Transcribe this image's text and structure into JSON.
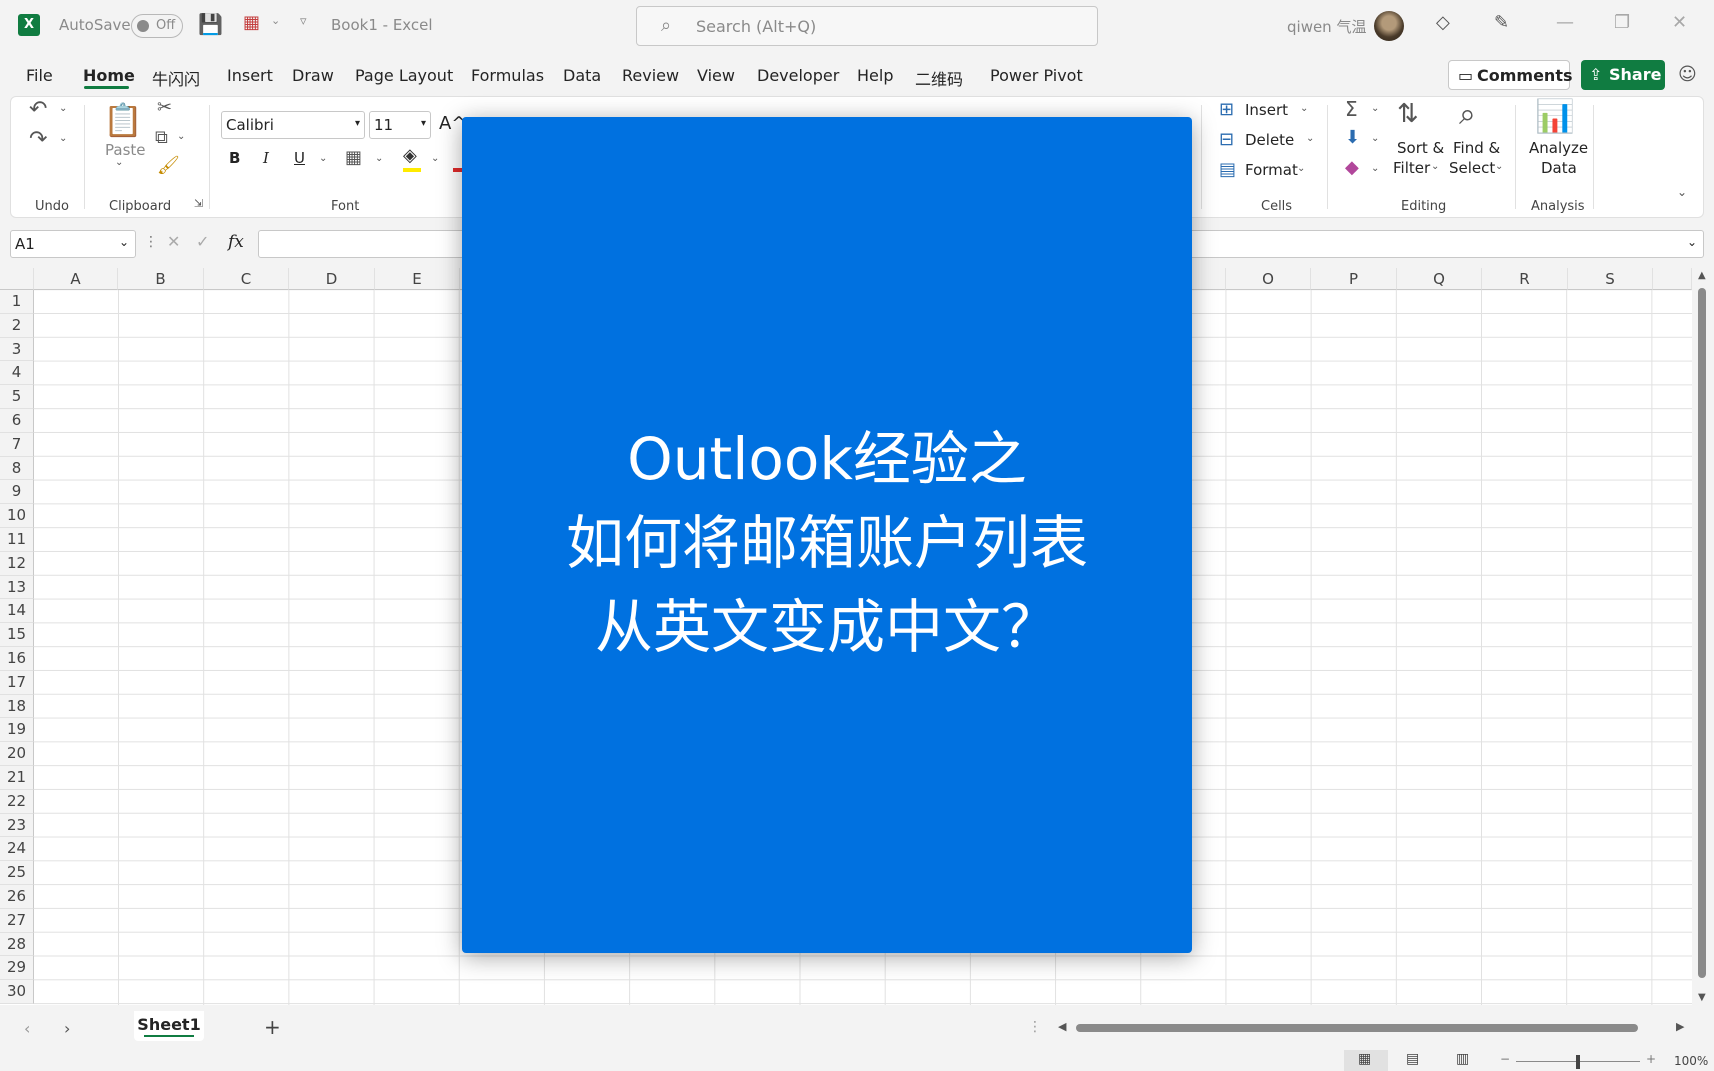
{
  "titlebar": {
    "autosave_label": "AutoSave",
    "autosave_state": "Off",
    "document_title": "Book1  -  Excel",
    "search_placeholder": "Search (Alt+Q)",
    "user_name": "qiwen 气温"
  },
  "menu": {
    "tabs": [
      "File",
      "Home",
      "牛闪闪",
      "Insert",
      "Draw",
      "Page Layout",
      "Formulas",
      "Data",
      "Review",
      "View",
      "Developer",
      "Help",
      "二维码",
      "Power Pivot"
    ],
    "active_tab": "Home",
    "comments_label": "Comments",
    "share_label": "Share"
  },
  "ribbon": {
    "groups": {
      "undo": "Undo",
      "clipboard": "Clipboard",
      "font": "Font",
      "cells": "Cells",
      "editing": "Editing",
      "analysis": "Analysis"
    },
    "paste_label": "Paste",
    "font_name": "Calibri",
    "font_size": "11",
    "bold": "B",
    "italic": "I",
    "underline": "U",
    "insert_label": "Insert",
    "delete_label": "Delete",
    "format_label": "Format",
    "sort_filter_label_1": "Sort &",
    "sort_filter_label_2": "Filter",
    "find_select_label_1": "Find &",
    "find_select_label_2": "Select",
    "analyze_label_1": "Analyze",
    "analyze_label_2": "Data"
  },
  "formula": {
    "name_box": "A1",
    "fx": "fx"
  },
  "grid": {
    "left_columns": [
      "A",
      "B",
      "C",
      "D",
      "E"
    ],
    "right_columns": [
      "O",
      "P",
      "Q",
      "R",
      "S"
    ],
    "rows": [
      "1",
      "2",
      "3",
      "4",
      "5",
      "6",
      "7",
      "8",
      "9",
      "10",
      "11",
      "12",
      "13",
      "14",
      "15",
      "16",
      "17",
      "18",
      "19",
      "20",
      "21",
      "22",
      "23",
      "24",
      "25",
      "26",
      "27",
      "28",
      "29",
      "30"
    ]
  },
  "sheets": {
    "active_sheet": "Sheet1"
  },
  "status": {
    "zoom": "100%"
  },
  "overlay": {
    "line1": "Outlook经验之",
    "line2": "如何将邮箱账户列表",
    "line3": "从英文变成中文？",
    "background_color": "#0071e0"
  },
  "colors": {
    "brand_green": "#107c41",
    "overlay_blue": "#0071e0"
  }
}
